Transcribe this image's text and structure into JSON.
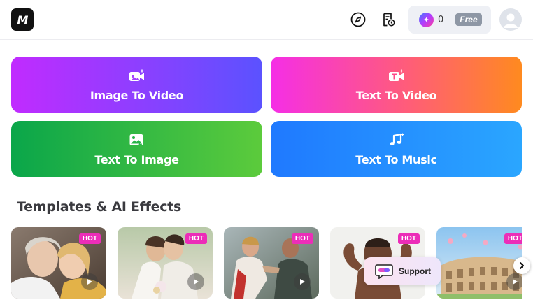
{
  "header": {
    "logo_text": "M",
    "credits": {
      "count": "0",
      "plan": "Free"
    }
  },
  "features": [
    {
      "label": "Image To Video",
      "icon": "camera-video-icon"
    },
    {
      "label": "Text To Video",
      "icon": "text-video-icon"
    },
    {
      "label": "Text To Image",
      "icon": "ai-image-icon"
    },
    {
      "label": "Text To Music",
      "icon": "music-note-icon"
    }
  ],
  "templates": {
    "title": "Templates & AI Effects",
    "cards": [
      {
        "badge": "HOT",
        "scene": "hug"
      },
      {
        "badge": "HOT",
        "scene": "wedding-kiss"
      },
      {
        "badge": "HOT",
        "scene": "fighters"
      },
      {
        "badge": "HOT",
        "scene": "baby-muscles"
      },
      {
        "badge": "HOT",
        "scene": "colosseum"
      }
    ]
  },
  "support": {
    "label": "Support"
  },
  "colors": {
    "image_to_video": [
      "#c12bff",
      "#5b52ff"
    ],
    "text_to_video": [
      "#f52ee6",
      "#ff8a1f"
    ],
    "text_to_image": [
      "#0aa64a",
      "#5ccb3c"
    ],
    "text_to_music": [
      "#1f79ff",
      "#2aa6ff"
    ],
    "hot_badge": "#ec2db8"
  }
}
